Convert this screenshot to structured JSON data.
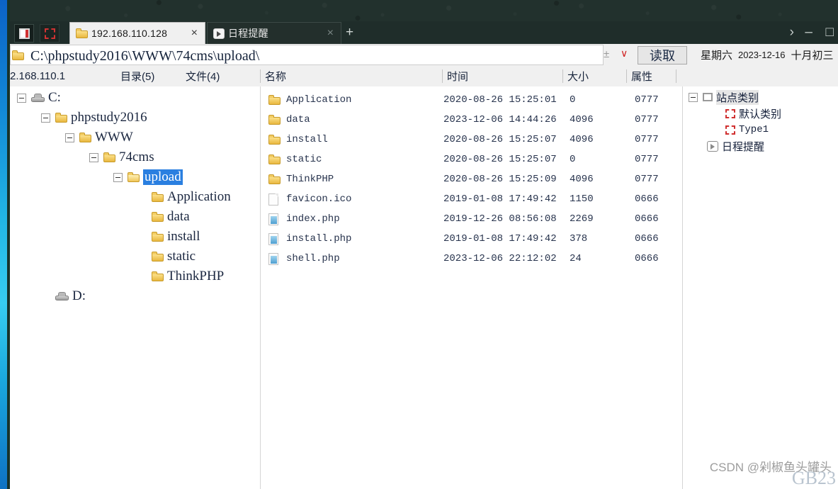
{
  "window": {
    "controls": {
      "chevron": "›",
      "minimize": "–",
      "maximize": "□"
    },
    "toolbar_icons": [
      {
        "name": "app-window-icon"
      },
      {
        "name": "selection-box-icon"
      }
    ],
    "tabs": [
      {
        "label": "192.168.110.128",
        "icon": "folder-icon",
        "close": "×",
        "active": true
      },
      {
        "label": "日程提醒",
        "icon": "clock-icon",
        "close": "×",
        "active": false
      }
    ],
    "new_tab_label": "+"
  },
  "addressbar": {
    "icon": "folder-icon",
    "path": "C:\\phpstudy2016\\WWW\\74cms\\upload\\",
    "plusminus_label": "±",
    "dropdown_caret": "∨",
    "read_button": "读取"
  },
  "datebar": {
    "weekday": "星期六",
    "date": "2023-12-16",
    "lunar": "十月初三"
  },
  "columns": {
    "host": "2.168.110.1",
    "dir_count": "目录(5)",
    "file_count": "文件(4)",
    "name": "名称",
    "time": "时间",
    "size": "大小",
    "attr": "属性"
  },
  "tree": [
    {
      "label": "C:",
      "icon": "drive-icon",
      "indent": 0,
      "toggle": true,
      "selected": false
    },
    {
      "label": "phpstudy2016",
      "icon": "folder-icon",
      "indent": 1,
      "toggle": true,
      "selected": false
    },
    {
      "label": "WWW",
      "icon": "folder-icon",
      "indent": 2,
      "toggle": true,
      "selected": false
    },
    {
      "label": "74cms",
      "icon": "folder-icon",
      "indent": 3,
      "toggle": true,
      "selected": false
    },
    {
      "label": "upload",
      "icon": "folder-open-icon",
      "indent": 4,
      "toggle": true,
      "selected": true
    },
    {
      "label": "Application",
      "icon": "folder-icon",
      "indent": 5,
      "toggle": false,
      "selected": false
    },
    {
      "label": "data",
      "icon": "folder-icon",
      "indent": 5,
      "toggle": false,
      "selected": false
    },
    {
      "label": "install",
      "icon": "folder-icon",
      "indent": 5,
      "toggle": false,
      "selected": false
    },
    {
      "label": "static",
      "icon": "folder-icon",
      "indent": 5,
      "toggle": false,
      "selected": false
    },
    {
      "label": "ThinkPHP",
      "icon": "folder-icon",
      "indent": 5,
      "toggle": false,
      "selected": false
    },
    {
      "label": "D:",
      "icon": "drive-icon",
      "indent": 1,
      "toggle": false,
      "selected": false
    }
  ],
  "files": [
    {
      "name": "Application",
      "time": "2020-08-26 15:25:01",
      "size": "0",
      "attr": "0777",
      "icon": "folder-icon"
    },
    {
      "name": "data",
      "time": "2023-12-06 14:44:26",
      "size": "4096",
      "attr": "0777",
      "icon": "folder-icon"
    },
    {
      "name": "install",
      "time": "2020-08-26 15:25:07",
      "size": "4096",
      "attr": "0777",
      "icon": "folder-icon"
    },
    {
      "name": "static",
      "time": "2020-08-26 15:25:07",
      "size": "0",
      "attr": "0777",
      "icon": "folder-icon"
    },
    {
      "name": "ThinkPHP",
      "time": "2020-08-26 15:25:09",
      "size": "4096",
      "attr": "0777",
      "icon": "folder-icon"
    },
    {
      "name": "favicon.ico",
      "time": "2019-01-08 17:49:42",
      "size": "1150",
      "attr": "0666",
      "icon": "file-icon"
    },
    {
      "name": "index.php",
      "time": "2019-12-26 08:56:08",
      "size": "2269",
      "attr": "0666",
      "icon": "php-file-icon"
    },
    {
      "name": "install.php",
      "time": "2019-01-08 17:49:42",
      "size": "378",
      "attr": "0666",
      "icon": "php-file-icon"
    },
    {
      "name": "shell.php",
      "time": "2023-12-06 22:12:02",
      "size": "24",
      "attr": "0666",
      "icon": "php-file-icon"
    }
  ],
  "right_panel": [
    {
      "label": "站点类别",
      "icon": "box-icon",
      "indent": 0,
      "toggle": true,
      "highlight": true,
      "mono": false
    },
    {
      "label": "默认类别",
      "icon": "dashed-box-icon",
      "indent": 2,
      "toggle": false,
      "highlight": false,
      "mono": false
    },
    {
      "label": "Type1",
      "icon": "dashed-box-icon",
      "indent": 2,
      "toggle": false,
      "highlight": false,
      "mono": true
    },
    {
      "label": "日程提醒",
      "icon": "clock-icon",
      "indent": 1,
      "toggle": false,
      "highlight": false,
      "mono": false
    }
  ],
  "watermark": {
    "text": "CSDN @剁椒鱼头罐头",
    "sub": "GB23"
  },
  "colors": {
    "titlebar": "#1f2d2a",
    "selection": "#2a7fe0",
    "accent_red": "#d03232",
    "folder": "#e9b83f"
  }
}
